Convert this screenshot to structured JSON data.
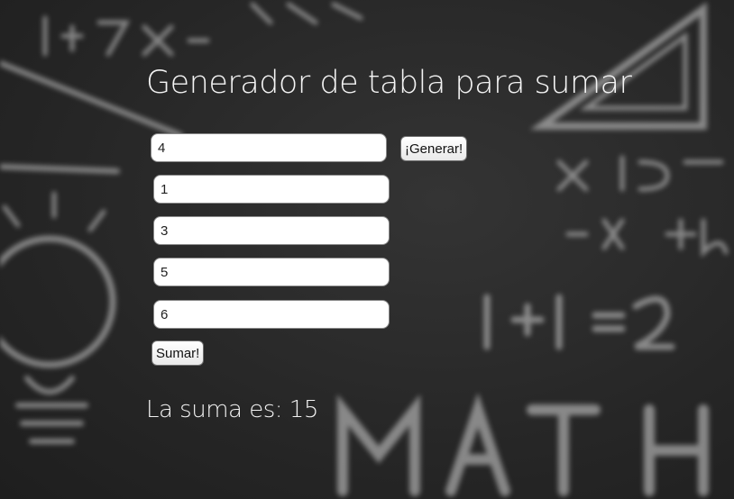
{
  "title": "Generador de tabla para sumar",
  "count_input": {
    "value": "4"
  },
  "generate_button": {
    "label": "¡Generar!"
  },
  "number_inputs": [
    {
      "value": "1"
    },
    {
      "value": "3"
    },
    {
      "value": "5"
    },
    {
      "value": "6"
    }
  ],
  "sum_button": {
    "label": "Sumar!"
  },
  "result_text": "La suma es: 15",
  "colors": {
    "background": "#2a2a2a",
    "text": "#f4f4f4",
    "input_bg": "#ffffff"
  }
}
